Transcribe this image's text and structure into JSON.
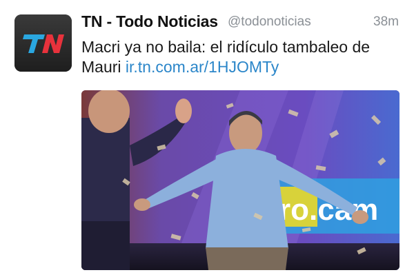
{
  "tweet": {
    "display_name": "TN - Todo Noticias",
    "handle": "@todonoticias",
    "time": "38m",
    "text": "Macri ya no baila: el ridículo tambaleo de Mauri",
    "link": "ir.tn.com.ar/1HJOMTy",
    "avatar_icon": "tn-logo-icon",
    "avatar_logo_text": "TN",
    "media_icon": "photo-media",
    "media_banner_text": "ro.cam"
  },
  "colors": {
    "link": "#2b86c9",
    "name": "#111111",
    "meta": "#8a8f95",
    "logo_red": "#e8323c",
    "logo_blue": "#2aa7e0",
    "stage_purple": "#5a3fb0"
  }
}
